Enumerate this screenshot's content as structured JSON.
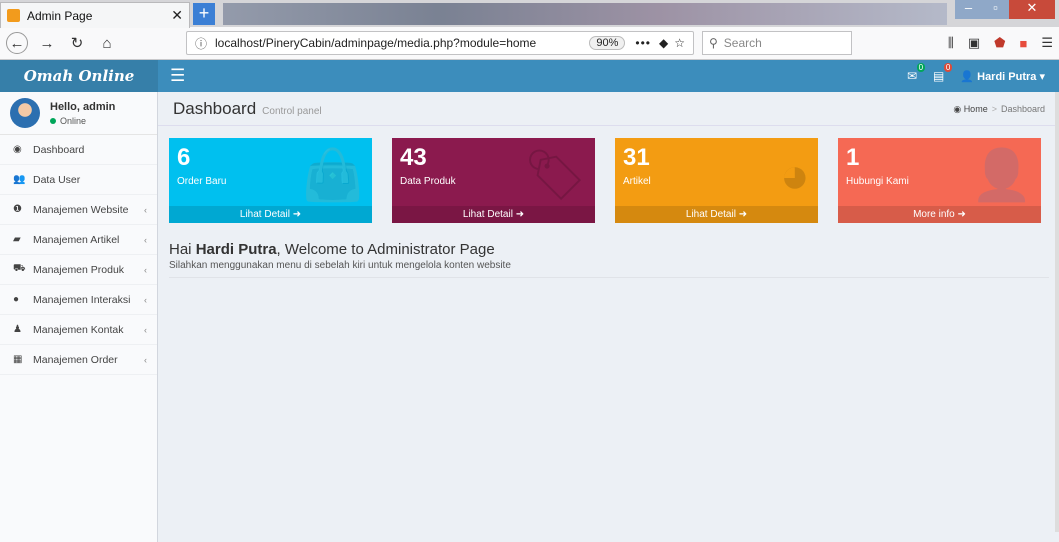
{
  "browser": {
    "tab_title": "Admin Page",
    "url": "localhost/PineryCabin/adminpage/media.php?module=home",
    "zoom": "90%",
    "search_placeholder": "Search"
  },
  "app": {
    "logo": "Omah Online",
    "user_name": "Hardi Putra",
    "mail_badge": "0",
    "notif_badge": "0"
  },
  "sidebar": {
    "hello": "Hello, admin",
    "status": "Online",
    "items": [
      {
        "label": "Dashboard",
        "icon": "dashboard-icon",
        "arrow": false
      },
      {
        "label": "Data User",
        "icon": "users-icon",
        "arrow": false
      },
      {
        "label": "Manajemen Website",
        "icon": "info-icon",
        "arrow": true
      },
      {
        "label": "Manajemen Artikel",
        "icon": "book-icon",
        "arrow": true
      },
      {
        "label": "Manajemen Produk",
        "icon": "cart-icon",
        "arrow": true
      },
      {
        "label": "Manajemen Interaksi",
        "icon": "comments-icon",
        "arrow": true
      },
      {
        "label": "Manajemen Kontak",
        "icon": "person-icon",
        "arrow": true
      },
      {
        "label": "Manajemen Order",
        "icon": "chart-icon",
        "arrow": true
      }
    ]
  },
  "header": {
    "title": "Dashboard",
    "subtitle": "Control panel",
    "crumb_home": "Home",
    "crumb_current": "Dashboard"
  },
  "boxes": [
    {
      "value": "6",
      "label": "Order Baru",
      "footer": "Lihat Detail",
      "color": "#00c0ef",
      "icon": "bag-icon"
    },
    {
      "value": "43",
      "label": "Data Produk",
      "footer": "Lihat Detail",
      "color": "#8b1a4e",
      "icon": "tag-icon"
    },
    {
      "value": "31",
      "label": "Artikel",
      "footer": "Lihat Detail",
      "color": "#f39c12",
      "icon": "pie-icon"
    },
    {
      "value": "1",
      "label": "Hubungi Kami",
      "footer": "More info",
      "color": "#f56954",
      "icon": "user-add-icon"
    }
  ],
  "welcome": {
    "prefix": "Hai ",
    "name": "Hardi Putra",
    "suffix": ", Welcome to Administrator Page",
    "subtitle": "Silahkan menggunakan menu di sebelah kiri untuk mengelola konten website"
  }
}
